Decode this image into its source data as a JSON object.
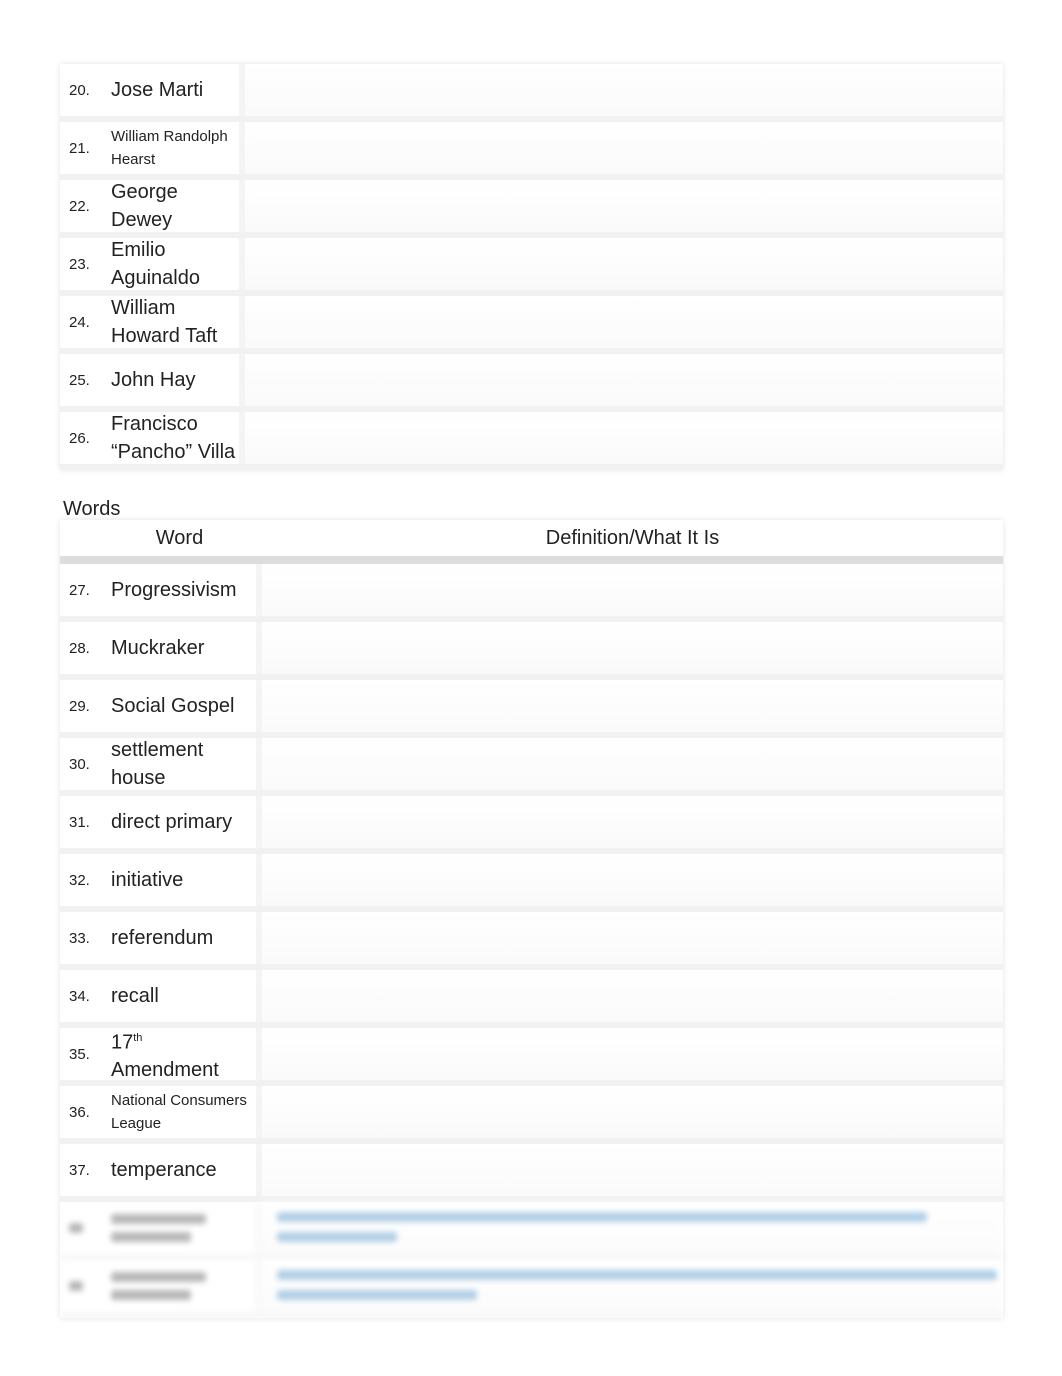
{
  "people_rows": [
    {
      "num": "20.",
      "name": "Jose Marti",
      "small": false
    },
    {
      "num": "21.",
      "name": "William Randolph Hearst",
      "small": true
    },
    {
      "num": "22.",
      "name": "George Dewey",
      "small": false
    },
    {
      "num": "23.",
      "name": "Emilio Aguinaldo",
      "small": false
    },
    {
      "num": "24.",
      "name": "William Howard Taft",
      "small": false
    },
    {
      "num": "25.",
      "name": "John Hay",
      "small": false
    },
    {
      "num": "26.",
      "name": "Francisco “Pancho” Villa",
      "small": false
    }
  ],
  "words": {
    "heading": "Words",
    "col_word": "Word",
    "col_definition": "Definition/What It Is",
    "rows": [
      {
        "num": "27.",
        "name": "Progressivism",
        "small": false
      },
      {
        "num": "28.",
        "name": "Muckraker",
        "small": false
      },
      {
        "num": "29.",
        "name": "Social Gospel",
        "small": false
      },
      {
        "num": "30.",
        "name": "settlement house",
        "small": false
      },
      {
        "num": "31.",
        "name": "direct primary",
        "small": false
      },
      {
        "num": "32.",
        "name": "initiative",
        "small": false
      },
      {
        "num": "33.",
        "name": "referendum",
        "small": false
      },
      {
        "num": "34.",
        "name": "recall",
        "small": false
      },
      {
        "num": "35.",
        "name": "17",
        "sup": "th",
        "name2": "Amendment",
        "small": false
      },
      {
        "num": "36.",
        "name": "National Consumers League",
        "small": true
      },
      {
        "num": "37.",
        "name": "temperance",
        "small": false
      }
    ]
  }
}
